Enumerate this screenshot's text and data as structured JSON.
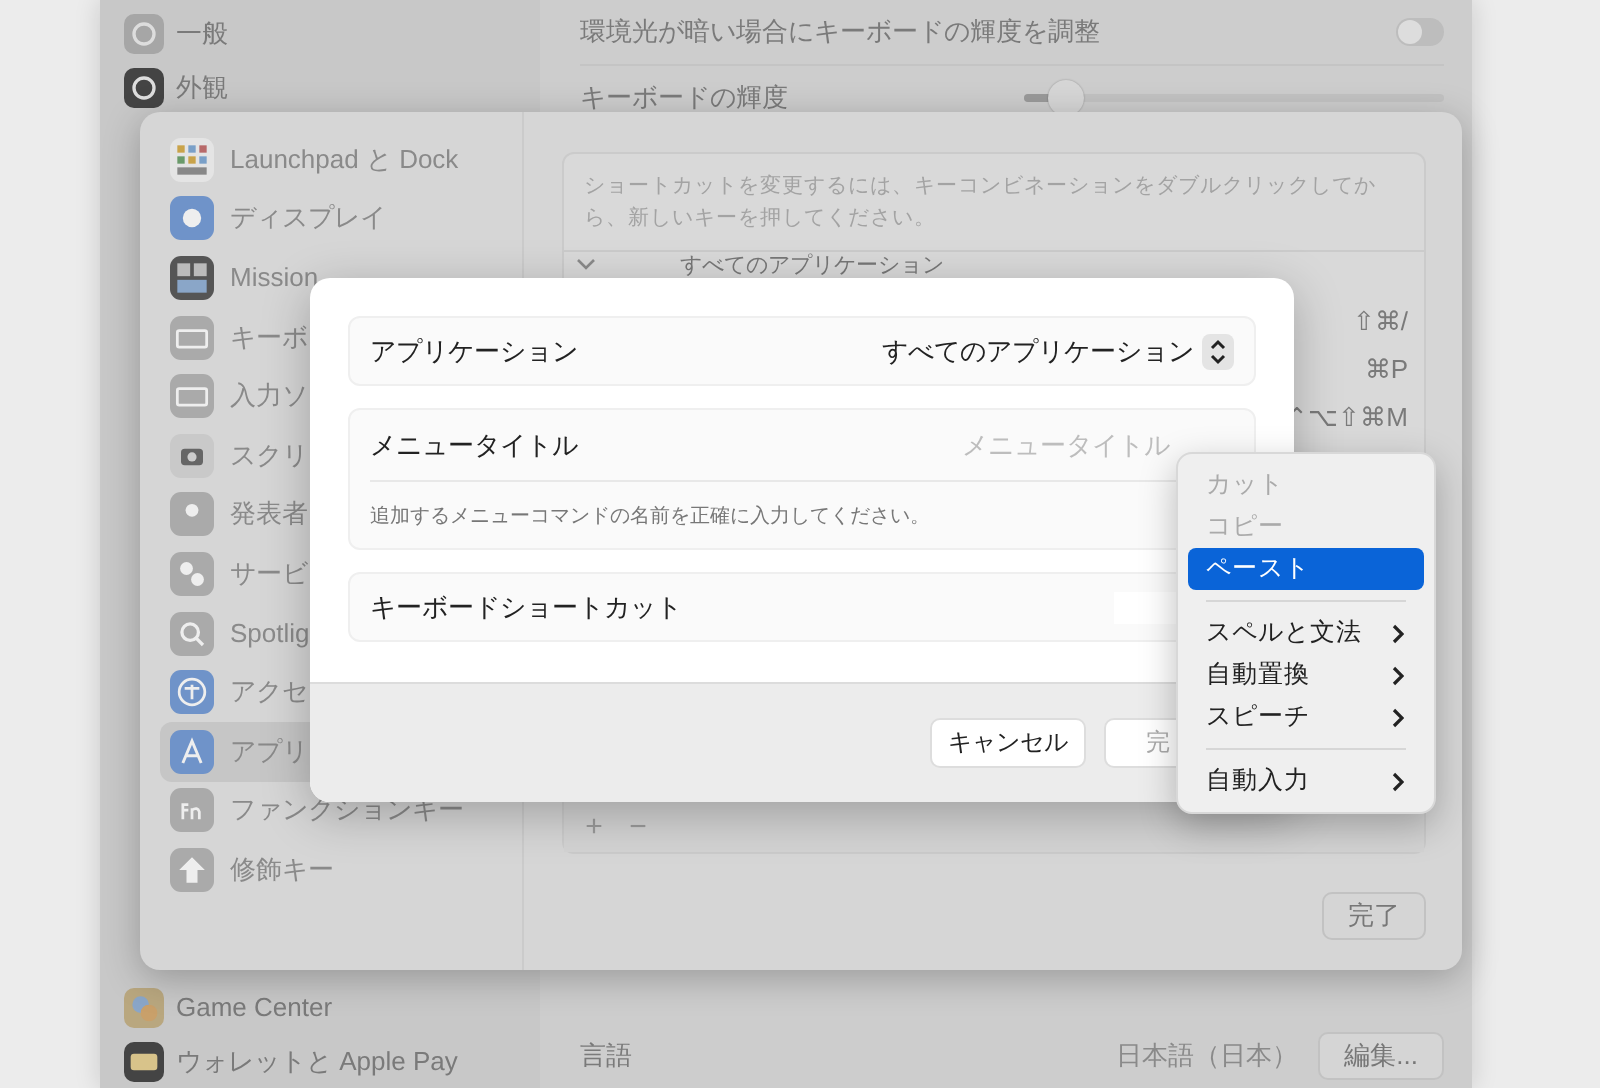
{
  "settings_window": {
    "sidebar_top": [
      {
        "label": "一般"
      },
      {
        "label": "外観"
      }
    ],
    "sidebar_bottom": [
      {
        "label": "Game Center"
      },
      {
        "label": "ウォレットと Apple Pay"
      }
    ],
    "ambient_row": {
      "label": "環境光が暗い場合にキーボードの輝度を調整",
      "on": false
    },
    "brightness_row": {
      "label": "キーボードの輝度",
      "level": 0.1
    },
    "language_row": {
      "label": "言語",
      "value": "日本語（日本）",
      "button": "編集..."
    }
  },
  "keyboard_sheet": {
    "sidebar": [
      {
        "label": "Launchpad と Dock",
        "selected": false
      },
      {
        "label": "ディスプレイ",
        "selected": false
      },
      {
        "label": "Mission",
        "selected": false
      },
      {
        "label": "キーボ",
        "selected": false
      },
      {
        "label": "入力ソ",
        "selected": false
      },
      {
        "label": "スクリ",
        "selected": false
      },
      {
        "label": "発表者",
        "selected": false
      },
      {
        "label": "サービ",
        "selected": false
      },
      {
        "label": "Spotlig",
        "selected": false
      },
      {
        "label": "アクセ",
        "selected": false
      },
      {
        "label": "アプリ",
        "selected": true
      },
      {
        "label": "ファンクションキー",
        "selected": false
      },
      {
        "label": "修飾キー",
        "selected": false
      }
    ],
    "hint": "ショートカットを変更するには、キーコンビネーションをダブルクリックしてから、新しいキーを押してください。",
    "group": {
      "label": "すべてのアプリケーション",
      "expanded": true
    },
    "shortcuts": [
      "⇧⌘/",
      "⌘P",
      "⌃⌥⇧⌘M"
    ],
    "add_button": "+",
    "remove_button": "−",
    "done_button": "完了"
  },
  "dialog": {
    "application": {
      "label": "アプリケーション",
      "value": "すべてのアプリケーション"
    },
    "menu_title": {
      "label": "メニュータイトル",
      "placeholder": "メニュータイトル",
      "hint": "追加するメニューコマンドの名前を正確に入力してください。"
    },
    "shortcut": {
      "label": "キーボードショートカット"
    },
    "cancel_button": "キャンセル",
    "done_button": "完"
  },
  "context_menu": {
    "items": [
      {
        "kind": "item",
        "label": "カット",
        "disabled": true,
        "selected": false,
        "submenu": false
      },
      {
        "kind": "item",
        "label": "コピー",
        "disabled": true,
        "selected": false,
        "submenu": false
      },
      {
        "kind": "item",
        "label": "ペースト",
        "disabled": false,
        "selected": true,
        "submenu": false
      },
      {
        "kind": "separator"
      },
      {
        "kind": "item",
        "label": "スペルと文法",
        "disabled": false,
        "selected": false,
        "submenu": true
      },
      {
        "kind": "item",
        "label": "自動置換",
        "disabled": false,
        "selected": false,
        "submenu": true
      },
      {
        "kind": "item",
        "label": "スピーチ",
        "disabled": false,
        "selected": false,
        "submenu": true
      },
      {
        "kind": "separator"
      },
      {
        "kind": "item",
        "label": "自動入力",
        "disabled": false,
        "selected": false,
        "submenu": true
      }
    ]
  }
}
